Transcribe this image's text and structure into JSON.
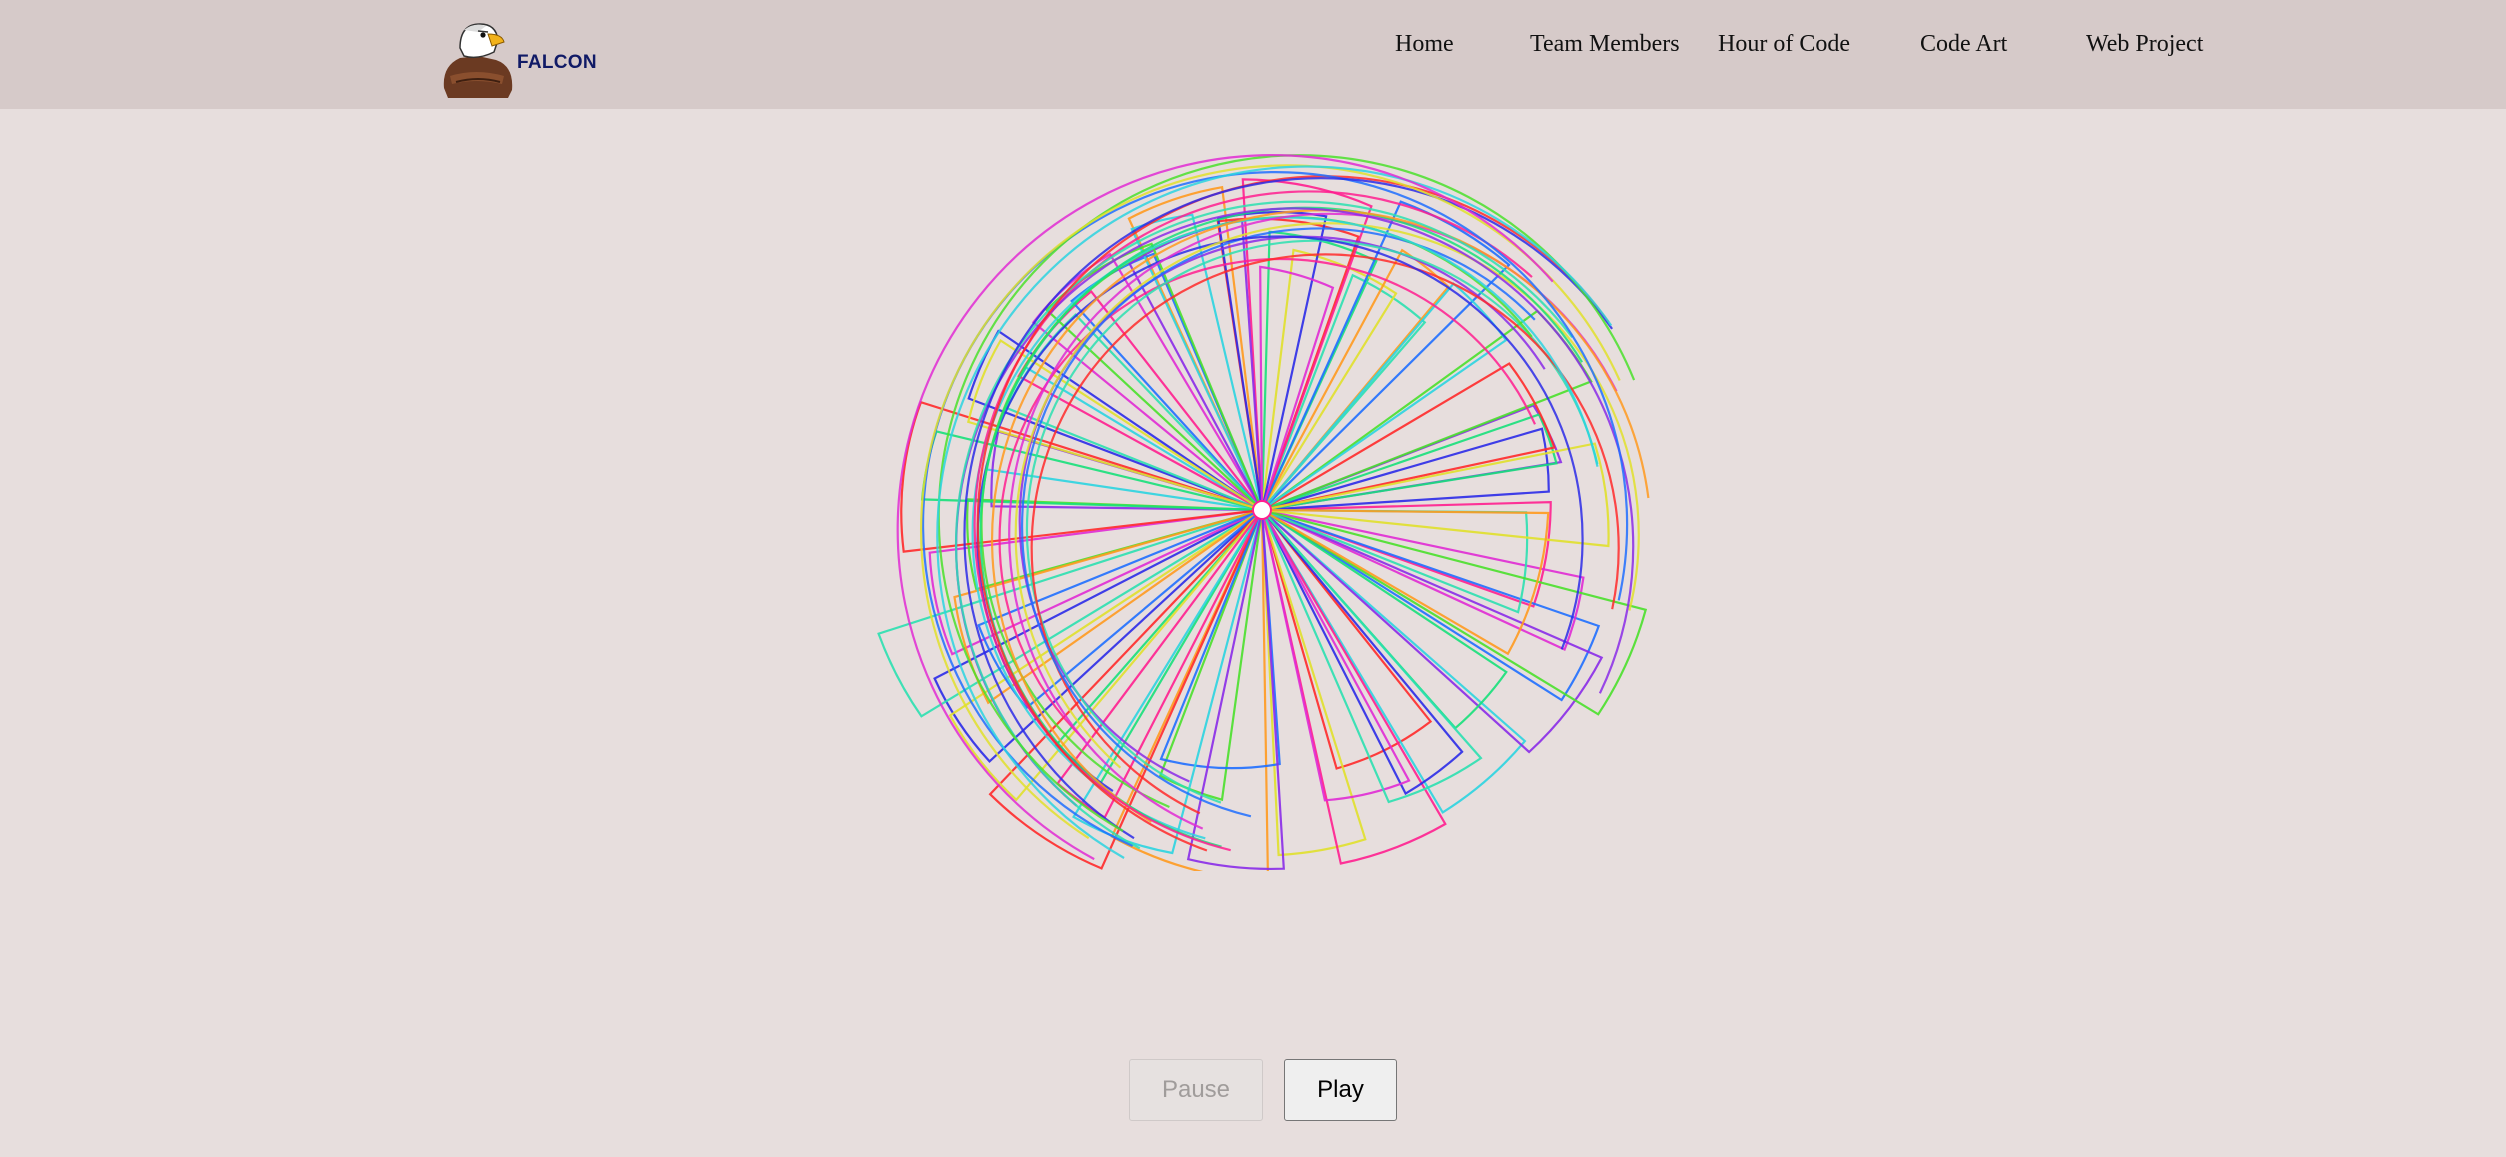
{
  "header": {
    "logo_text": "FALCON",
    "nav": [
      {
        "label": "Home"
      },
      {
        "label": "Team Members"
      },
      {
        "label": "Hour of Code"
      },
      {
        "label": "Code Art"
      },
      {
        "label": "Web Project"
      }
    ]
  },
  "art": {
    "palette": [
      "#ff1f8f",
      "#2b2be8",
      "#17e07a",
      "#ff2a2a",
      "#2bd4e0",
      "#8a2be8",
      "#4ae02b",
      "#ff9a1f",
      "#1f6fff",
      "#e02bd4",
      "#2be0b0",
      "#e0e02b"
    ]
  },
  "controls": {
    "pause_label": "Pause",
    "play_label": "Play",
    "pause_disabled": true
  }
}
